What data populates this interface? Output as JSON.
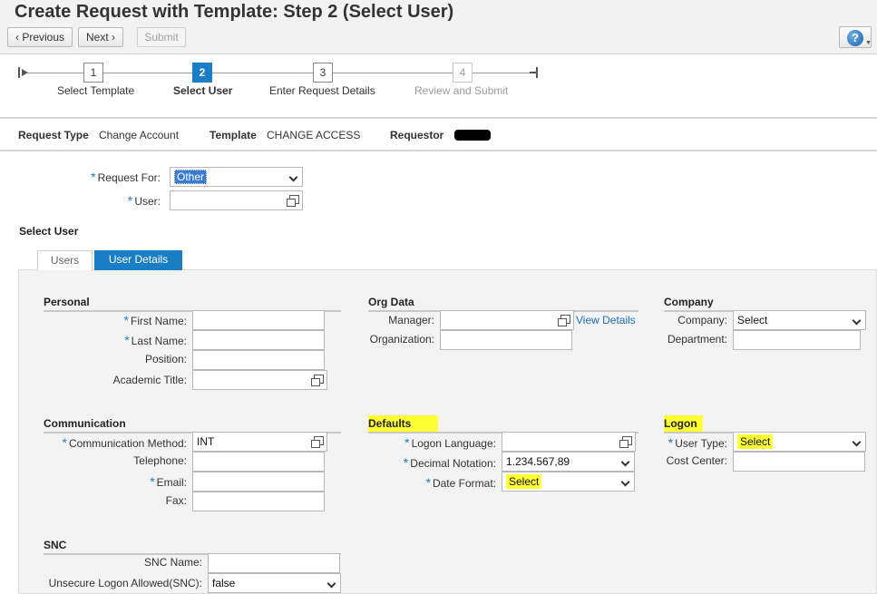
{
  "header": {
    "title": "Create Request with Template: Step 2  (Select User)",
    "previous_label": "Previous",
    "next_label": "Next",
    "submit_label": "Submit",
    "help_glyph": "?"
  },
  "roadmap": {
    "steps": [
      {
        "number": "1",
        "label": "Select Template"
      },
      {
        "number": "2",
        "label": "Select User"
      },
      {
        "number": "3",
        "label": "Enter Request Details"
      },
      {
        "number": "4",
        "label": "Review and Submit"
      }
    ],
    "active_step": 2
  },
  "info": {
    "request_type_label": "Request Type",
    "request_type_value": "Change Account",
    "template_label": "Template",
    "template_value": "CHANGE ACCESS",
    "requestor_label": "Requestor"
  },
  "request": {
    "request_for_label": "Request For:",
    "request_for_value": "Other",
    "user_label": "User:",
    "user_value": ""
  },
  "select_user": {
    "title": "Select User",
    "tabs": [
      "Users",
      "User Details"
    ],
    "active_tab": "User Details"
  },
  "personal": {
    "title": "Personal",
    "first_name_label": "First Name:",
    "last_name_label": "Last Name:",
    "position_label": "Position:",
    "academic_title_label": "Academic Title:"
  },
  "org_data": {
    "title": "Org Data",
    "manager_label": "Manager:",
    "view_details_label": "View Details",
    "organization_label": "Organization:"
  },
  "company": {
    "title": "Company",
    "company_label": "Company:",
    "company_value": "Select",
    "department_label": "Department:"
  },
  "communication": {
    "title": "Communication",
    "method_label": "Communication Method:",
    "method_value": "INT",
    "telephone_label": "Telephone:",
    "email_label": "Email:",
    "fax_label": "Fax:"
  },
  "defaults": {
    "title": "Defaults",
    "logon_language_label": "Logon Language:",
    "decimal_notation_label": "Decimal Notation:",
    "decimal_notation_value": "1.234.567,89",
    "date_format_label": "Date Format:",
    "date_format_value": "Select"
  },
  "logon": {
    "title": "Logon",
    "user_type_label": "User Type:",
    "user_type_value": "Select",
    "cost_center_label": "Cost Center:"
  },
  "snc": {
    "title": "SNC",
    "snc_name_label": "SNC Name:",
    "unsecure_logon_label": "Unsecure Logon Allowed(SNC):",
    "unsecure_logon_value": "false"
  },
  "colors": {
    "accent": "#1a7ec6",
    "highlight": "#ffff33",
    "panel_bg": "#f3f3f3"
  }
}
